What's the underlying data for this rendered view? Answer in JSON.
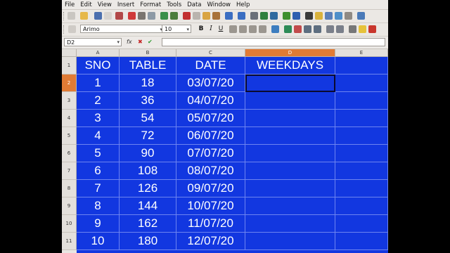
{
  "menu": [
    "File",
    "Edit",
    "View",
    "Insert",
    "Format",
    "Tools",
    "Data",
    "Window",
    "Help"
  ],
  "toolbar": {
    "font_name": "Arimo",
    "font_size": "10"
  },
  "formula_bar": {
    "cell_ref": "D2",
    "fx_label": "fx",
    "content": ""
  },
  "sheet": {
    "columns": [
      "A",
      "B",
      "C",
      "D",
      "E"
    ],
    "active_column": "D",
    "active_row": "2",
    "rows": [
      {
        "num": "1",
        "cells": [
          "SNO",
          "TABLE",
          "DATE",
          "WEEKDAYS",
          ""
        ]
      },
      {
        "num": "2",
        "cells": [
          "1",
          "18",
          "03/07/20",
          "",
          ""
        ]
      },
      {
        "num": "3",
        "cells": [
          "2",
          "36",
          "04/07/20",
          "",
          ""
        ]
      },
      {
        "num": "4",
        "cells": [
          "3",
          "54",
          "05/07/20",
          "",
          ""
        ]
      },
      {
        "num": "5",
        "cells": [
          "4",
          "72",
          "06/07/20",
          "",
          ""
        ]
      },
      {
        "num": "6",
        "cells": [
          "5",
          "90",
          "07/07/20",
          "",
          ""
        ]
      },
      {
        "num": "7",
        "cells": [
          "6",
          "108",
          "08/07/20",
          "",
          ""
        ]
      },
      {
        "num": "8",
        "cells": [
          "7",
          "126",
          "09/07/20",
          "",
          ""
        ]
      },
      {
        "num": "9",
        "cells": [
          "8",
          "144",
          "10/07/20",
          "",
          ""
        ]
      },
      {
        "num": "10",
        "cells": [
          "9",
          "162",
          "11/07/20",
          "",
          ""
        ]
      },
      {
        "num": "11",
        "cells": [
          "10",
          "180",
          "12/07/20",
          "",
          ""
        ]
      }
    ]
  },
  "colors": {
    "cell_background": "#1237e0",
    "selection_header": "#e07b35",
    "cell_text": "#ffffff"
  }
}
